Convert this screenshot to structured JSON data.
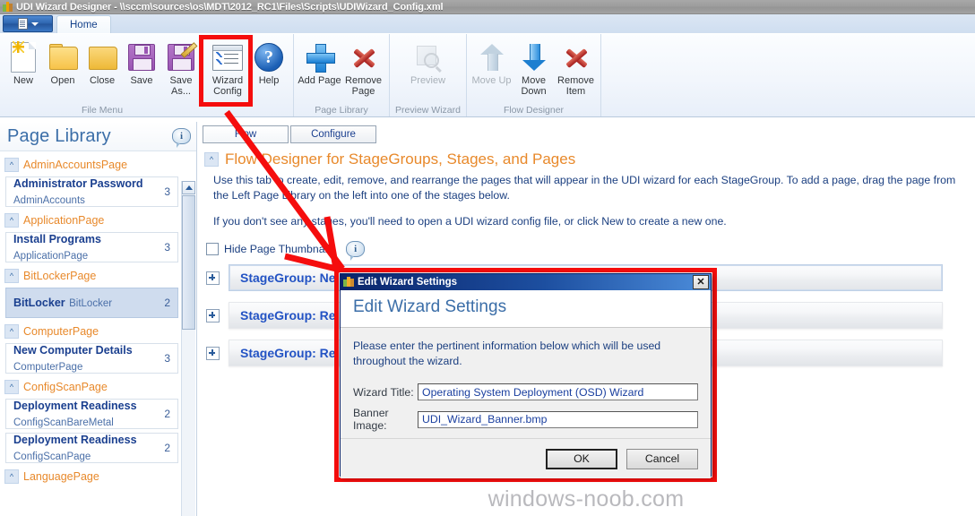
{
  "window": {
    "title": "UDI Wizard Designer - \\\\sccm\\sources\\os\\MDT\\2012_RC1\\Files\\Scripts\\UDIWizard_Config.xml",
    "icon": "udi-app-icon"
  },
  "ribbon": {
    "app_button": "office-orb-button",
    "tabs": [
      {
        "label": "Home",
        "active": true
      }
    ],
    "groups": [
      {
        "label": "File Menu",
        "items": [
          {
            "label": "New",
            "icon": "new-document-icon",
            "enabled": true
          },
          {
            "label": "Open",
            "icon": "open-folder-icon",
            "enabled": true
          },
          {
            "label": "Close",
            "icon": "close-folder-icon",
            "enabled": true
          },
          {
            "label": "Save",
            "icon": "save-disk-icon",
            "enabled": true
          },
          {
            "label": "Save As...",
            "icon": "save-as-disk-icon",
            "enabled": true
          },
          {
            "label": "Wizard Config",
            "icon": "wizard-config-icon",
            "enabled": true,
            "highlighted": true
          },
          {
            "label": "Help",
            "icon": "help-question-icon",
            "enabled": true
          }
        ]
      },
      {
        "label": "Page Library",
        "items": [
          {
            "label": "Add Page",
            "icon": "plus-icon",
            "enabled": true
          },
          {
            "label": "Remove Page",
            "icon": "red-x-icon",
            "enabled": true
          }
        ]
      },
      {
        "label": "Preview Wizard",
        "items": [
          {
            "label": "Preview",
            "icon": "preview-magnifier-icon",
            "enabled": false
          }
        ]
      },
      {
        "label": "Flow Designer",
        "items": [
          {
            "label": "Move Up",
            "icon": "arrow-up-icon",
            "enabled": false
          },
          {
            "label": "Move Down",
            "icon": "arrow-down-icon",
            "enabled": true
          },
          {
            "label": "Remove Item",
            "icon": "red-x-icon",
            "enabled": true
          }
        ]
      }
    ]
  },
  "sidebar": {
    "title": "Page Library",
    "info_icon": "info-bubble-icon",
    "groups": [
      {
        "name": "AdminAccountsPage",
        "collapse_glyph": "^",
        "pages": [
          {
            "title": "Administrator Password",
            "subtitle": "AdminAccounts",
            "count": "3",
            "selected": false
          }
        ]
      },
      {
        "name": "ApplicationPage",
        "collapse_glyph": "^",
        "pages": [
          {
            "title": "Install Programs",
            "subtitle": "ApplicationPage",
            "count": "3",
            "selected": false
          }
        ]
      },
      {
        "name": "BitLockerPage",
        "collapse_glyph": "^",
        "pages": [
          {
            "title": "BitLocker",
            "subtitle": "BitLocker",
            "count": "2",
            "selected": true
          }
        ]
      },
      {
        "name": "ComputerPage",
        "collapse_glyph": "^",
        "pages": [
          {
            "title": "New Computer Details",
            "subtitle": "ComputerPage",
            "count": "3",
            "selected": false
          }
        ]
      },
      {
        "name": "ConfigScanPage",
        "collapse_glyph": "^",
        "pages": [
          {
            "title": "Deployment Readiness",
            "subtitle": "ConfigScanBareMetal",
            "count": "2",
            "selected": false
          },
          {
            "title": "Deployment Readiness",
            "subtitle": "ConfigScanPage",
            "count": "2",
            "selected": false
          }
        ]
      },
      {
        "name": "LanguagePage",
        "collapse_glyph": "^",
        "pages": []
      }
    ]
  },
  "content": {
    "tabs": [
      {
        "label": "Flow",
        "active": true
      },
      {
        "label": "Configure",
        "active": false
      }
    ],
    "section": {
      "collapse_glyph": "^",
      "title": "Flow Designer for StageGroups, Stages, and Pages",
      "paragraph1": "Use this tab to create, edit, remove, and rearrange the pages that will appear in the UDI wizard for each StageGroup. To add a page, drag the page from the Left Page Library on the left into one of the stages below.",
      "paragraph2": "If you don't see any stages, you'll need to open a UDI wizard config file, or click New to create a new one."
    },
    "hide_thumbnails": {
      "label": "Hide Page Thumbnails",
      "checked": false
    },
    "thumbs_info_icon": "info-bubble-icon",
    "stages": [
      {
        "label": "StageGroup: Ne",
        "expand_glyph": "+",
        "selected": true
      },
      {
        "label": "StageGroup: Re",
        "expand_glyph": "+",
        "selected": false
      },
      {
        "label": "StageGroup: Re",
        "expand_glyph": "+",
        "selected": false
      }
    ],
    "watermark": "windows-noob.com"
  },
  "dialog": {
    "titlebar_text": "Edit Wizard Settings",
    "titlebar_icon": "udi-app-icon",
    "close_glyph": "✕",
    "banner_heading": "Edit Wizard Settings",
    "message": "Please enter the pertinent information below which will be used throughout the wizard.",
    "fields": [
      {
        "label": "Wizard Title:",
        "value": "Operating System Deployment (OSD) Wizard"
      },
      {
        "label": "Banner Image:",
        "value": "UDI_Wizard_Banner.bmp"
      }
    ],
    "buttons": [
      {
        "label": "OK",
        "default": true
      },
      {
        "label": "Cancel",
        "default": false
      }
    ]
  },
  "annotations": {
    "highlight_color": "#f50d0d",
    "boxes": [
      {
        "name": "wizard-config-highlight"
      },
      {
        "name": "dialog-highlight"
      }
    ],
    "arrow": {
      "name": "red-pointer-arrow"
    }
  }
}
